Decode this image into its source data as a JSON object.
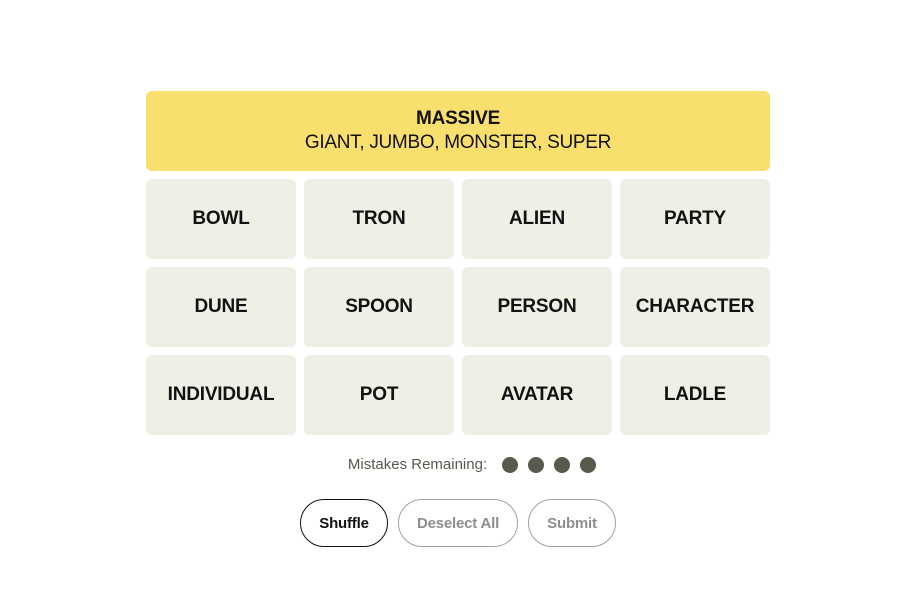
{
  "solved_groups": [
    {
      "title": "MASSIVE",
      "members": "GIANT, JUMBO, MONSTER, SUPER",
      "color": "#f9df6d"
    }
  ],
  "tiles": [
    "BOWL",
    "TRON",
    "ALIEN",
    "PARTY",
    "DUNE",
    "SPOON",
    "PERSON",
    "CHARACTER",
    "INDIVIDUAL",
    "POT",
    "AVATAR",
    "LADLE"
  ],
  "mistakes": {
    "label": "Mistakes Remaining:",
    "remaining": 4
  },
  "buttons": {
    "shuffle": "Shuffle",
    "deselect_all": "Deselect All",
    "submit": "Submit"
  },
  "colors": {
    "tile_bg": "#efefe6",
    "dot": "#5a594e"
  }
}
